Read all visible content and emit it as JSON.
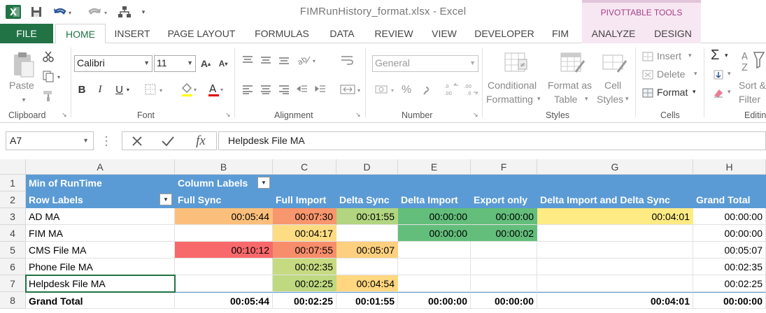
{
  "window": {
    "title": "FIMRunHistory_format.xlsx - Excel",
    "context_tab_group": "PIVOTTABLE TOOLS"
  },
  "ribbon_tabs": [
    "FILE",
    "HOME",
    "INSERT",
    "PAGE LAYOUT",
    "FORMULAS",
    "DATA",
    "REVIEW",
    "VIEW",
    "DEVELOPER",
    "FIM",
    "ANALYZE",
    "DESIGN"
  ],
  "active_tab": "HOME",
  "ribbon": {
    "clipboard": {
      "label": "Clipboard",
      "paste": "Paste"
    },
    "font": {
      "label": "Font",
      "name": "Calibri",
      "size": "11"
    },
    "alignment": {
      "label": "Alignment"
    },
    "number": {
      "label": "Number",
      "format": "General",
      "percent": "%"
    },
    "styles": {
      "label": "Styles",
      "conditional_1": "Conditional",
      "conditional_2": "Formatting",
      "format_table_1": "Format as",
      "format_table_2": "Table",
      "cell_styles_1": "Cell",
      "cell_styles_2": "Styles"
    },
    "cells": {
      "label": "Cells",
      "insert": "Insert",
      "delete": "Delete",
      "format": "Format"
    },
    "editing": {
      "label": "Editin",
      "sort_1": "Sort &",
      "sort_2": "Filter"
    }
  },
  "formula_bar": {
    "name_box": "A7",
    "formula": "Helpdesk File MA"
  },
  "columns": [
    "A",
    "B",
    "C",
    "D",
    "E",
    "F",
    "G",
    "H"
  ],
  "rows": [
    "1",
    "2",
    "3",
    "4",
    "5",
    "6",
    "7",
    "8"
  ],
  "pivot": {
    "value_field": "Min of RunTime",
    "column_labels": "Column Labels",
    "row_labels": "Row Labels",
    "col_headers": [
      "Full Sync",
      "Full Import",
      "Delta Sync",
      "Delta Import",
      "Export only",
      "Delta Import and Delta Sync",
      "Grand Total"
    ],
    "body": [
      {
        "label": "AD MA",
        "values": [
          "00:05:44",
          "00:07:30",
          "00:01:55",
          "00:00:00",
          "00:00:00",
          "00:04:01",
          "00:00:00"
        ]
      },
      {
        "label": "FIM MA",
        "values": [
          "",
          "00:04:17",
          "",
          "00:00:00",
          "00:00:02",
          "",
          "00:00:00"
        ]
      },
      {
        "label": "CMS File MA",
        "values": [
          "00:10:12",
          "00:07:55",
          "00:05:07",
          "",
          "",
          "",
          "00:05:07"
        ]
      },
      {
        "label": "Phone File MA",
        "values": [
          "",
          "00:02:35",
          "",
          "",
          "",
          "",
          "00:02:35"
        ]
      },
      {
        "label": "Helpdesk File MA",
        "values": [
          "",
          "00:02:25",
          "00:04:54",
          "",
          "",
          "",
          "00:02:25"
        ]
      }
    ],
    "grand_total": {
      "label": "Grand Total",
      "values": [
        "00:05:44",
        "00:02:25",
        "00:01:55",
        "00:00:00",
        "00:00:00",
        "00:04:01",
        "00:00:00"
      ]
    },
    "fills": [
      [
        "#fcbf7b",
        "#f8966d",
        "#b1d580",
        "#63be7b",
        "#63be7b",
        "#ffeb84",
        ""
      ],
      [
        "",
        "#fddc83",
        "",
        "#63be7b",
        "#63be7b",
        "",
        ""
      ],
      [
        "#f8696b",
        "#f88d6b",
        "#fdd07f",
        "",
        "",
        "",
        ""
      ],
      [
        "",
        "#c6db81",
        "",
        "",
        "",
        "",
        ""
      ],
      [
        "",
        "#bfd980",
        "#fed780",
        "",
        "",
        "",
        ""
      ]
    ]
  },
  "colors": {
    "excel_green": "#217346",
    "pivot_header_blue": "#5b9bd5",
    "context_pink": "#f7e7f2"
  }
}
